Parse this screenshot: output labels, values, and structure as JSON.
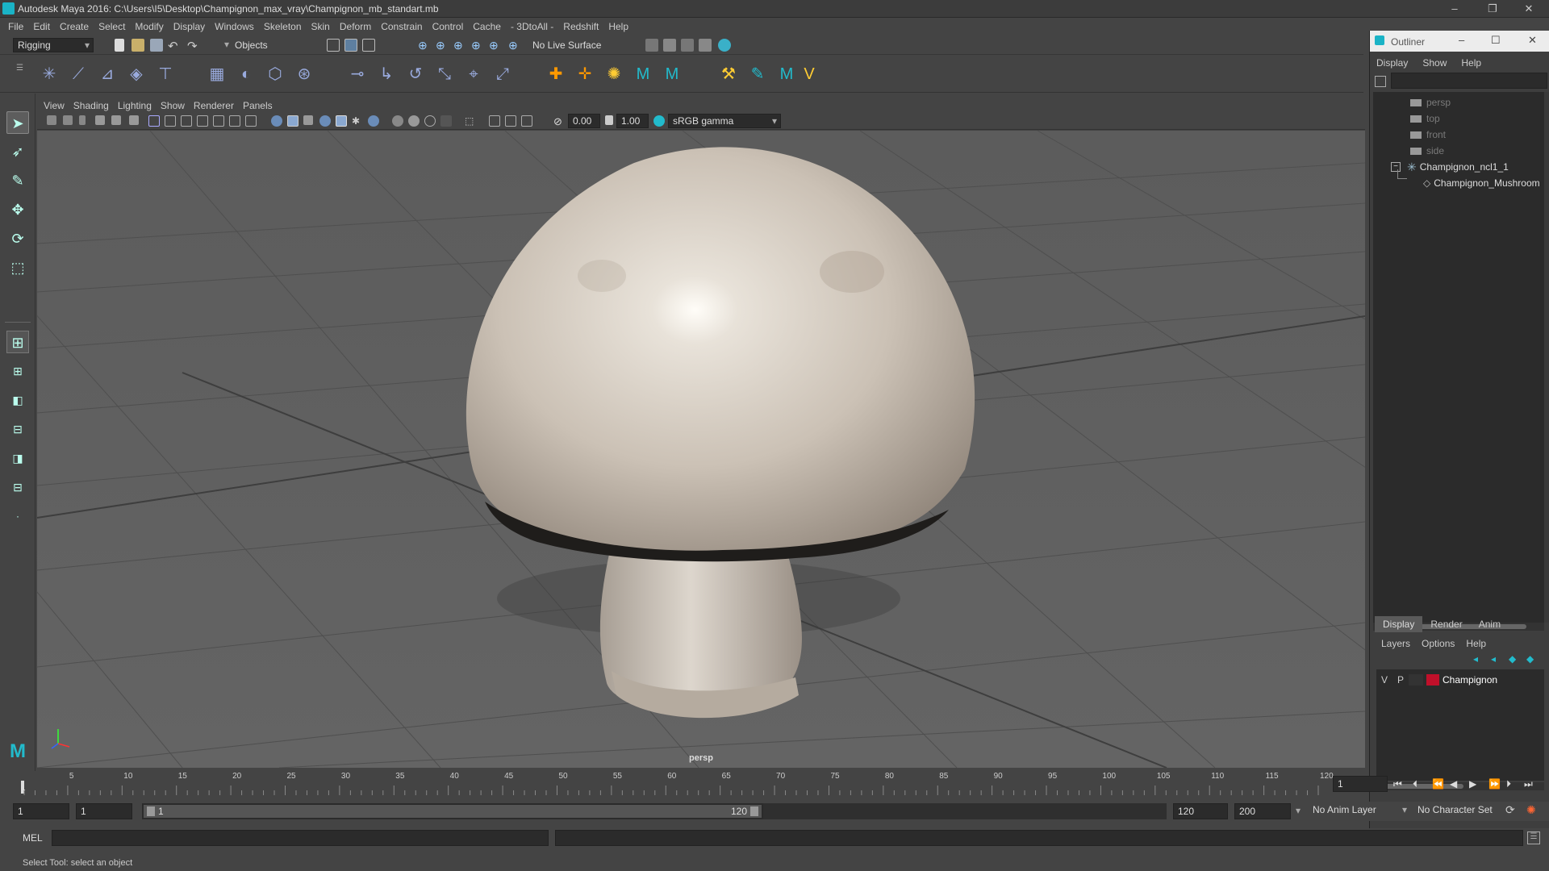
{
  "window": {
    "title": "Autodesk Maya 2016: C:\\Users\\I5\\Desktop\\Champignon_max_vray\\Champignon_mb_standart.mb",
    "minimize": "–",
    "restore": "❐",
    "close": "✕"
  },
  "menubar": [
    "File",
    "Edit",
    "Create",
    "Select",
    "Modify",
    "Display",
    "Windows",
    "Skeleton",
    "Skin",
    "Deform",
    "Constrain",
    "Control",
    "Cache",
    "- 3DtoAll -",
    "Redshift",
    "Help"
  ],
  "statusline": {
    "menu_set": "Rigging",
    "selection_mode": "Objects",
    "live_surface": "No Live Surface"
  },
  "panel_menu": [
    "View",
    "Shading",
    "Lighting",
    "Show",
    "Renderer",
    "Panels"
  ],
  "panel_toolbar": {
    "exposure": "0.00",
    "gamma": "1.00",
    "color_space": "sRGB gamma"
  },
  "viewport": {
    "camera_label": "persp",
    "cap_color": "#cfc6bd",
    "stem_color": "#d3cbc2",
    "grid_color": "#6b6b6b",
    "background": "#5e5e5e"
  },
  "outliner": {
    "title": "Outliner",
    "menu": [
      "Display",
      "Show",
      "Help"
    ],
    "items": [
      {
        "label": "persp",
        "dim": true
      },
      {
        "label": "top",
        "dim": true
      },
      {
        "label": "front",
        "dim": true
      },
      {
        "label": "side",
        "dim": true
      },
      {
        "label": "Champignon_ncl1_1",
        "dim": false
      },
      {
        "label": "Champignon_Mushroom",
        "dim": false
      }
    ]
  },
  "layer_editor": {
    "tabs": [
      "Display",
      "Render",
      "Anim"
    ],
    "menu": [
      "Layers",
      "Options",
      "Help"
    ],
    "layer": {
      "v": "V",
      "p": "P",
      "name": "Champignon",
      "color": "#c0102a"
    }
  },
  "time_slider": {
    "ticks": [
      "5",
      "10",
      "15",
      "20",
      "25",
      "30",
      "35",
      "40",
      "45",
      "50",
      "55",
      "60",
      "65",
      "70",
      "75",
      "80",
      "85",
      "90",
      "95",
      "100",
      "105",
      "110",
      "115",
      "120"
    ],
    "start_tick": "1",
    "current_frame": "1"
  },
  "range_slider": {
    "start": "1",
    "playback_start": "1",
    "range_left": "1",
    "range_right": "120",
    "playback_end": "120",
    "end": "200",
    "anim_layer": "No Anim Layer",
    "character_set": "No Character Set"
  },
  "command_line": {
    "label": "MEL"
  },
  "help_line": {
    "text": "Select Tool: select an object"
  }
}
